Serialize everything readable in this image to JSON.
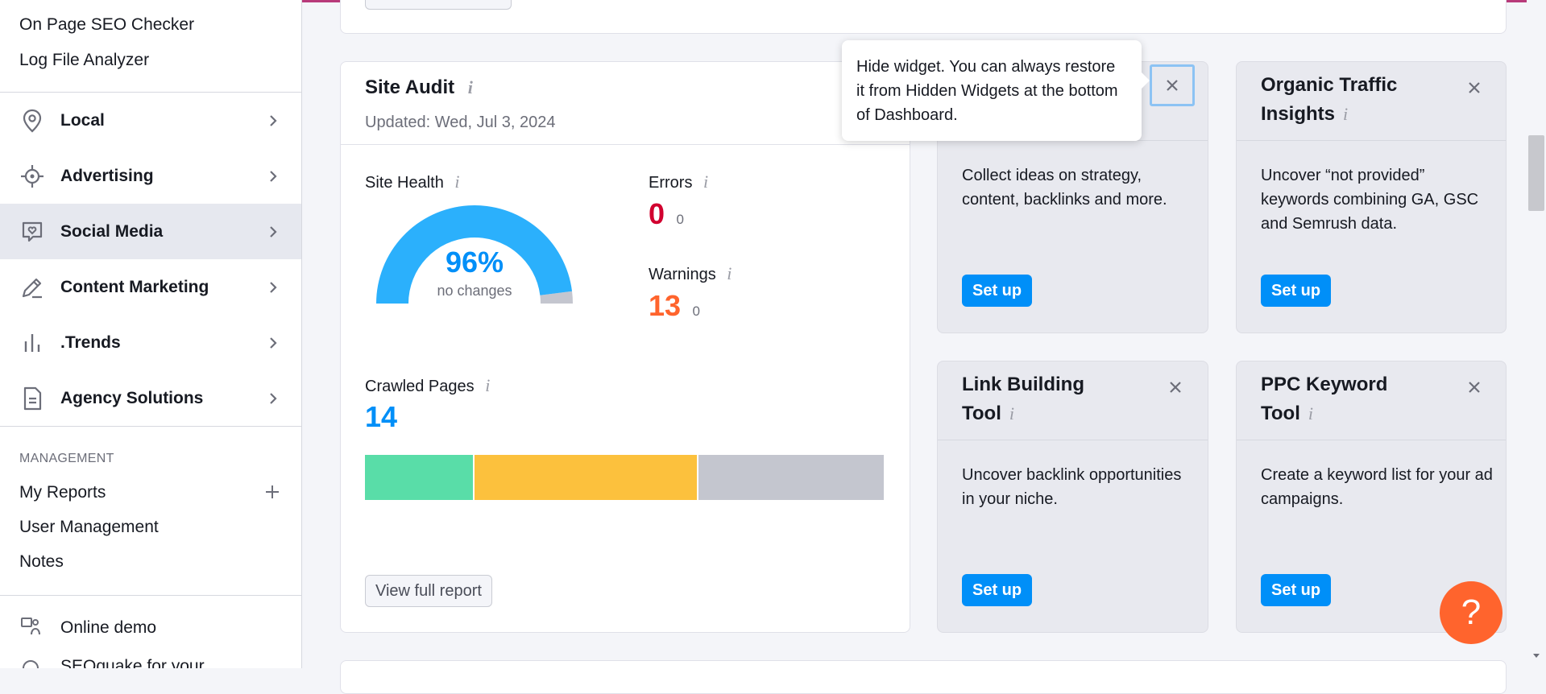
{
  "sidebar": {
    "top_links": [
      "On Page SEO Checker",
      "Log File Analyzer"
    ],
    "nav": [
      {
        "label": "Local",
        "icon": "location-pin-icon"
      },
      {
        "label": "Advertising",
        "icon": "target-icon"
      },
      {
        "label": "Social Media",
        "icon": "chat-heart-icon",
        "active": true
      },
      {
        "label": "Content Marketing",
        "icon": "pencil-icon"
      },
      {
        "label": ".Trends",
        "icon": "bar-chart-icon"
      },
      {
        "label": "Agency Solutions",
        "icon": "document-icon"
      }
    ],
    "management_label": "MANAGEMENT",
    "management_links": [
      "My Reports",
      "User Management",
      "Notes"
    ],
    "bottom_links": [
      "Online demo",
      "SEOquake for your"
    ]
  },
  "site_audit": {
    "title": "Site Audit",
    "updated": "Updated: Wed, Jul 3, 2024",
    "health_label": "Site Health",
    "health_value": "96%",
    "health_fraction": 0.96,
    "health_note": "no changes",
    "errors_label": "Errors",
    "errors_value": "0",
    "errors_delta": "0",
    "warnings_label": "Warnings",
    "warnings_value": "13",
    "warnings_delta": "0",
    "crawled_label": "Crawled Pages",
    "crawled_value": "14",
    "crawled_segments": [
      {
        "fraction": 0.21,
        "color": "#59dda8"
      },
      {
        "fraction": 0.43,
        "color": "#fcc13d"
      },
      {
        "fraction": 0.36,
        "color": "#c4c6cf"
      }
    ],
    "view_report": "View full report"
  },
  "tooltip": {
    "text": "Hide widget. You can always restore it from Hidden Widgets at the bottom of Dashboard."
  },
  "widgets": [
    {
      "title": "",
      "desc": "Collect ideas on strategy, content, backlinks and more.",
      "button": "Set up"
    },
    {
      "title_line1": "Organic Traffic",
      "title_line2": "Insights",
      "desc": "Uncover “not provided” keywords combining GA, GSC and Semrush data.",
      "button": "Set up"
    },
    {
      "title_line1": "Link Building",
      "title_line2": "Tool",
      "desc": "Uncover backlink opportunities in your niche.",
      "button": "Set up"
    },
    {
      "title_line1": "PPC Keyword",
      "title_line2": "Tool",
      "desc": "Create a keyword list for your ad campaigns.",
      "button": "Set up"
    }
  ],
  "help": {
    "label": "?"
  },
  "colors": {
    "accent_blue": "#008ff8",
    "health_blue": "#2bb0fc",
    "error_red": "#d1002f",
    "warning_orange": "#ff642d",
    "crawled_blue": "#008ff8",
    "help_orange": "#ff642d"
  }
}
